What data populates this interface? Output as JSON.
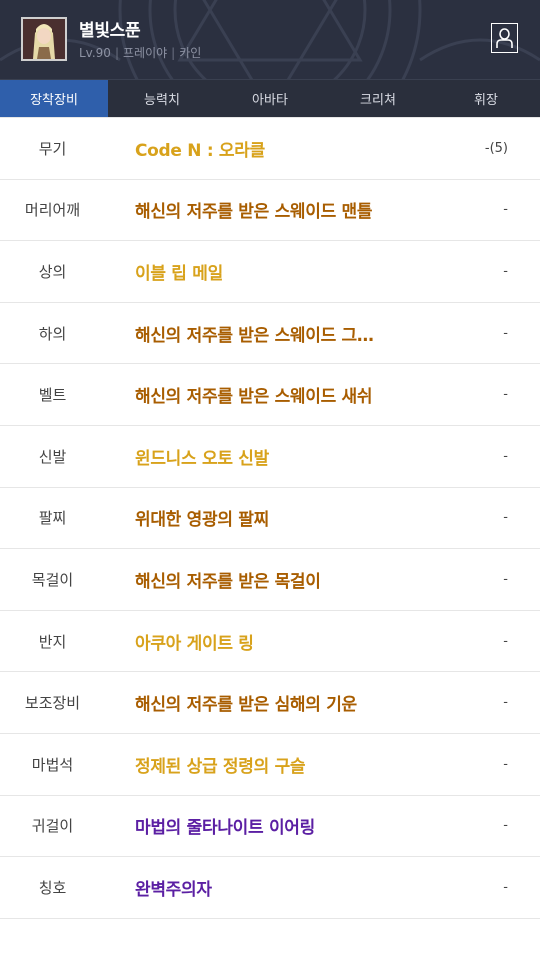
{
  "profile": {
    "name": "별빛스푼",
    "level": "Lv.90",
    "job": "프레이야",
    "world": "카인"
  },
  "tabs": [
    {
      "label": "장착장비",
      "active": true
    },
    {
      "label": "능력치",
      "active": false
    },
    {
      "label": "아바타",
      "active": false
    },
    {
      "label": "크리쳐",
      "active": false
    },
    {
      "label": "휘장",
      "active": false
    }
  ],
  "equipment": [
    {
      "slot": "무기",
      "item": "Code N : 오라클",
      "value": "-(5)",
      "color": "#d8a21b"
    },
    {
      "slot": "머리어깨",
      "item": "해신의 저주를 받은 스웨이드 맨틀",
      "value": "-",
      "color": "#a85d00"
    },
    {
      "slot": "상의",
      "item": "이블 립 메일",
      "value": "-",
      "color": "#d8a21b"
    },
    {
      "slot": "하의",
      "item": "해신의 저주를 받은 스웨이드 그…",
      "value": "-",
      "color": "#a85d00"
    },
    {
      "slot": "벨트",
      "item": "해신의 저주를 받은 스웨이드 새쉬",
      "value": "-",
      "color": "#a85d00"
    },
    {
      "slot": "신발",
      "item": "윈드니스 오토 신발",
      "value": "-",
      "color": "#d8a21b"
    },
    {
      "slot": "팔찌",
      "item": "위대한 영광의 팔찌",
      "value": "-",
      "color": "#a85d00"
    },
    {
      "slot": "목걸이",
      "item": "해신의 저주를 받은 목걸이",
      "value": "-",
      "color": "#a85d00"
    },
    {
      "slot": "반지",
      "item": "아쿠아 게이트 링",
      "value": "-",
      "color": "#d8a21b"
    },
    {
      "slot": "보조장비",
      "item": "해신의 저주를 받은 심해의 기운",
      "value": "-",
      "color": "#a85d00"
    },
    {
      "slot": "마법석",
      "item": "정제된 상급 정령의 구슬",
      "value": "-",
      "color": "#d8a21b"
    },
    {
      "slot": "귀걸이",
      "item": "마법의 줄타나이트 이어링",
      "value": "-",
      "color": "#5b1fa3"
    },
    {
      "slot": "칭호",
      "item": "완벽주의자",
      "value": "-",
      "color": "#5b1fa3"
    }
  ]
}
